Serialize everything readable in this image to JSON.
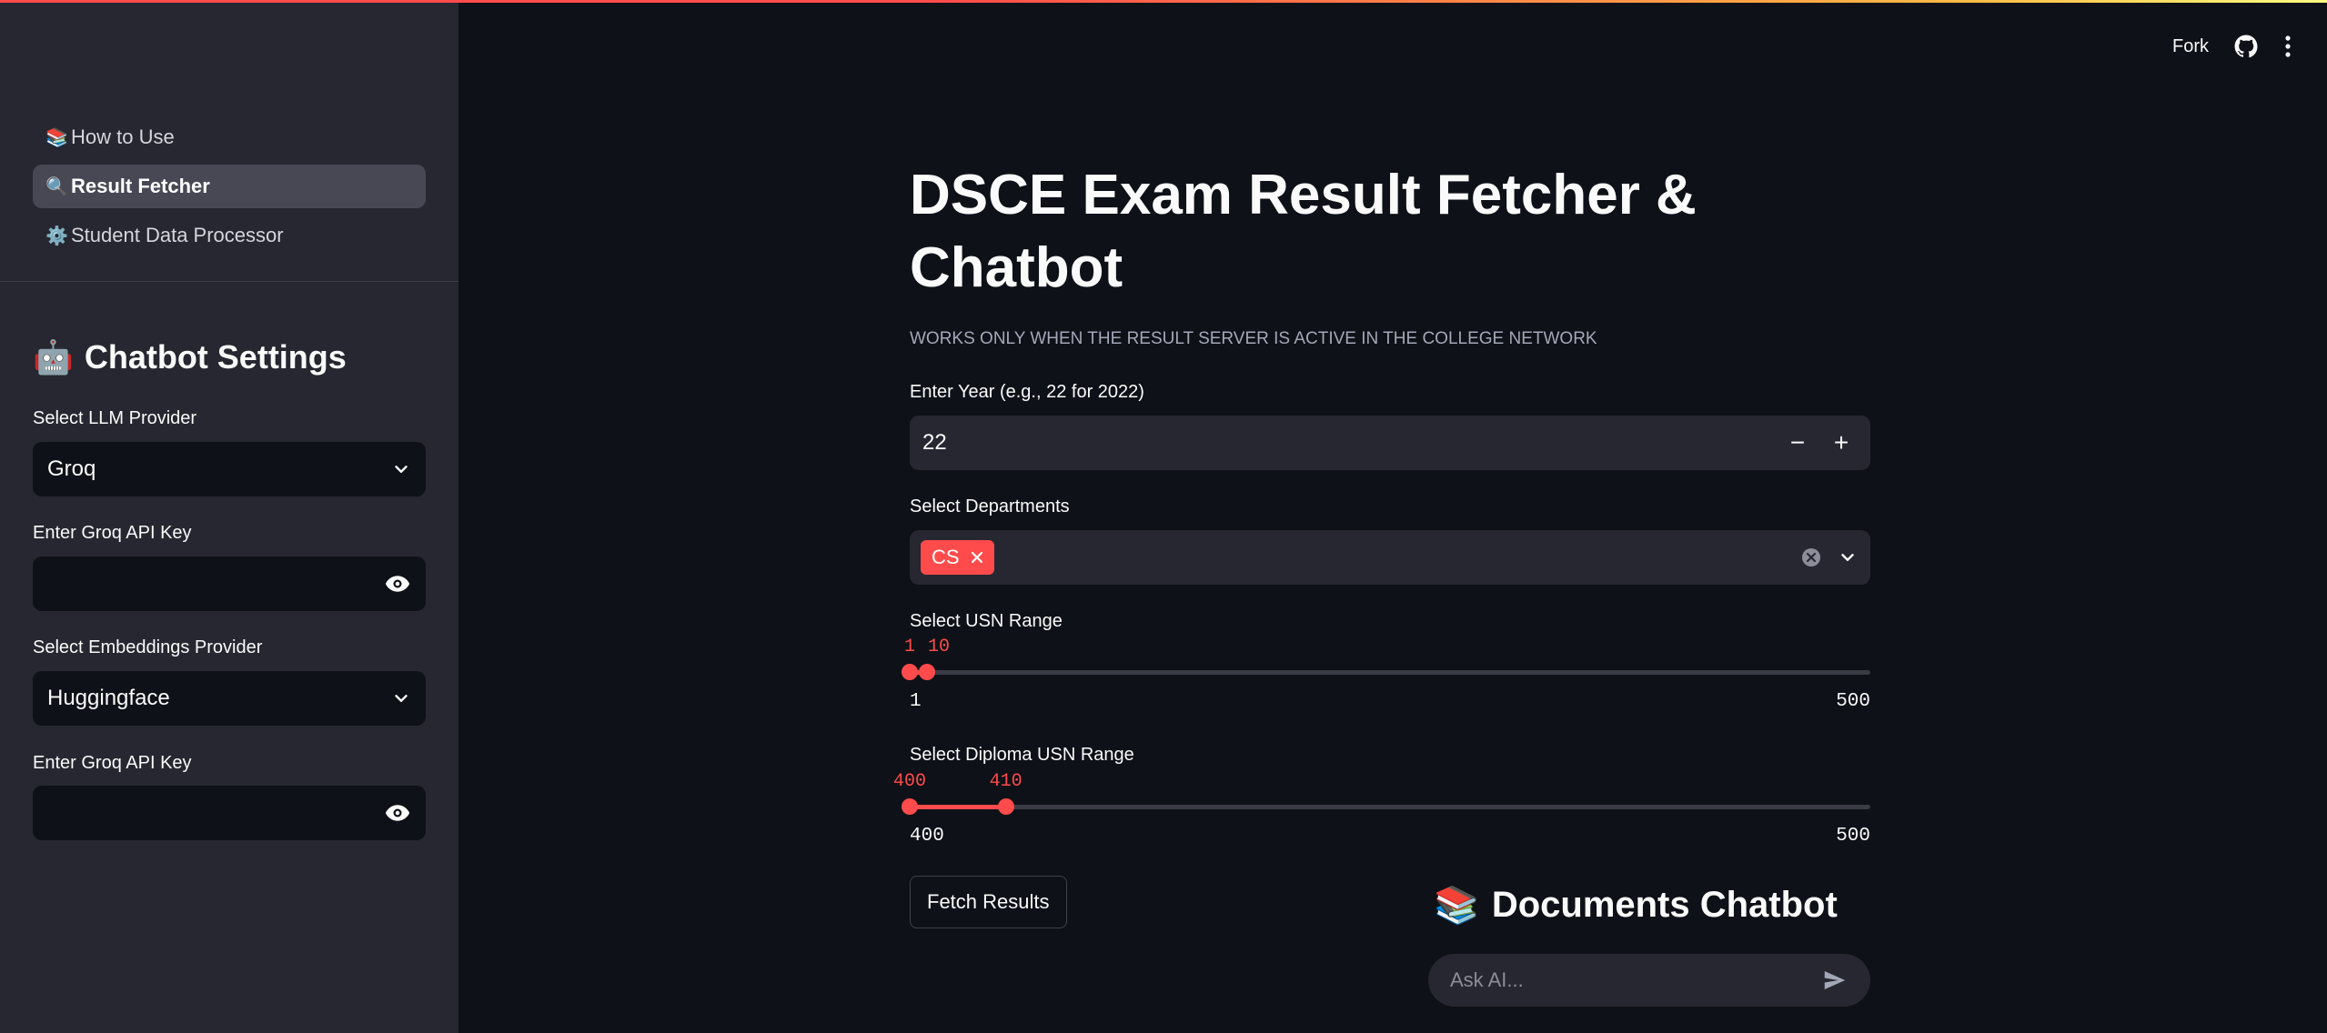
{
  "header": {
    "fork_label": "Fork",
    "github_icon": "github-icon",
    "menu_icon": "kebab-menu-icon"
  },
  "sidebar": {
    "nav": [
      {
        "icon": "📚",
        "label": "How to Use"
      },
      {
        "icon": "🔍",
        "label": "Result Fetcher",
        "active": true
      },
      {
        "icon": "⚙️",
        "label": "Student Data Processor"
      }
    ],
    "settings_icon": "🤖",
    "settings_title": "Chatbot Settings",
    "llm_provider_label": "Select LLM Provider",
    "llm_provider_value": "Groq",
    "groq_key_label": "Enter Groq API Key",
    "groq_key_value": "",
    "embeddings_provider_label": "Select Embeddings Provider",
    "embeddings_provider_value": "Huggingface",
    "embeddings_key_label": "Enter Groq API Key",
    "embeddings_key_value": ""
  },
  "main": {
    "title": "DSCE Exam Result Fetcher & Chatbot",
    "caption": "WORKS ONLY WHEN THE RESULT SERVER IS ACTIVE IN THE COLLEGE NETWORK",
    "year_label": "Enter Year (e.g., 22 for 2022)",
    "year_value": "22",
    "year_minus": "−",
    "year_plus": "+",
    "departments_label": "Select Departments",
    "departments": [
      "CS"
    ],
    "usn_range_label": "Select USN Range",
    "usn_range": {
      "min": 1,
      "max": 500,
      "low": "1",
      "high": "10",
      "min_label": "1",
      "max_label": "500"
    },
    "diploma_range_label": "Select Diploma USN Range",
    "diploma_range": {
      "min": 400,
      "max": 500,
      "low": "400",
      "high": "410",
      "min_label": "400",
      "max_label": "500"
    },
    "fetch_button": "Fetch Results",
    "chat_icon": "📚",
    "chat_title": "Documents Chatbot",
    "chat_placeholder": "Ask AI..."
  },
  "colors": {
    "accent": "#ff4b4b",
    "sidebar_bg": "#262730",
    "main_bg": "#0e1117"
  }
}
